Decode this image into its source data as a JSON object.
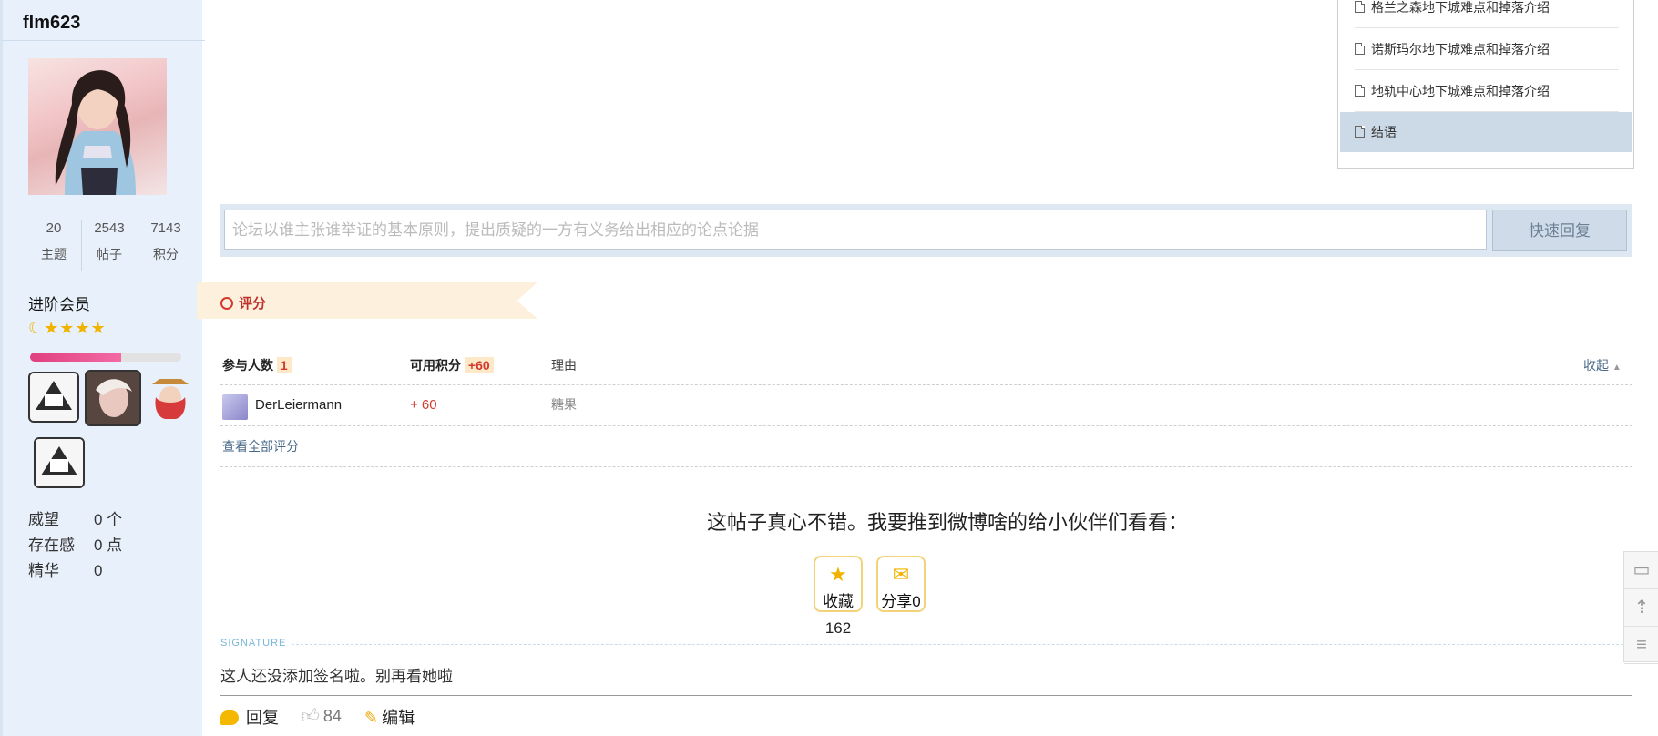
{
  "user": {
    "name": "flm623",
    "stats": [
      {
        "value": "20",
        "label": "主题"
      },
      {
        "value": "2543",
        "label": "帖子"
      },
      {
        "value": "7143",
        "label": "积分"
      }
    ],
    "group": "进阶会员",
    "stars": "☾★★★★",
    "level_progress": 0.6,
    "meta": [
      {
        "key": "威望",
        "value": "0 个"
      },
      {
        "key": "存在感",
        "value": "0 点"
      },
      {
        "key": "精华",
        "value": "0"
      }
    ]
  },
  "toc": {
    "items": [
      {
        "label": "格兰之森地下城难点和掉落介绍"
      },
      {
        "label": "诺斯玛尔地下城难点和掉落介绍"
      },
      {
        "label": "地轨中心地下城难点和掉落介绍"
      },
      {
        "label": "结语"
      }
    ]
  },
  "quick_reply": {
    "placeholder": "论坛以谁主张谁举证的基本原则，提出质疑的一方有义务给出相应的论点论据",
    "button": "快速回复"
  },
  "rating": {
    "title": "评分",
    "participants_label": "参与人数",
    "participants_count": "1",
    "points_label": "可用积分",
    "points_value": "+60",
    "reason_label": "理由",
    "collapse": "收起",
    "rows": [
      {
        "user": "DerLeiermann",
        "points": "+ 60",
        "reason": "糖果"
      }
    ],
    "view_all": "查看全部评分"
  },
  "share": {
    "text": "这帖子真心不错。我要推到微博啥的给小伙伴们看看：",
    "favorite_label": "收藏",
    "favorite_count": "162",
    "share_label": "分享0"
  },
  "signature": {
    "heading": "SIGNATURE",
    "text": "这人还没添加签名啦。别再看她啦"
  },
  "actions": {
    "reply": "回复",
    "likes": "84",
    "edit": "编辑"
  },
  "colors": {
    "sidebar_bg": "#e8f1fb",
    "accent_red": "#d23a2f",
    "star_yellow": "#f0b400"
  }
}
